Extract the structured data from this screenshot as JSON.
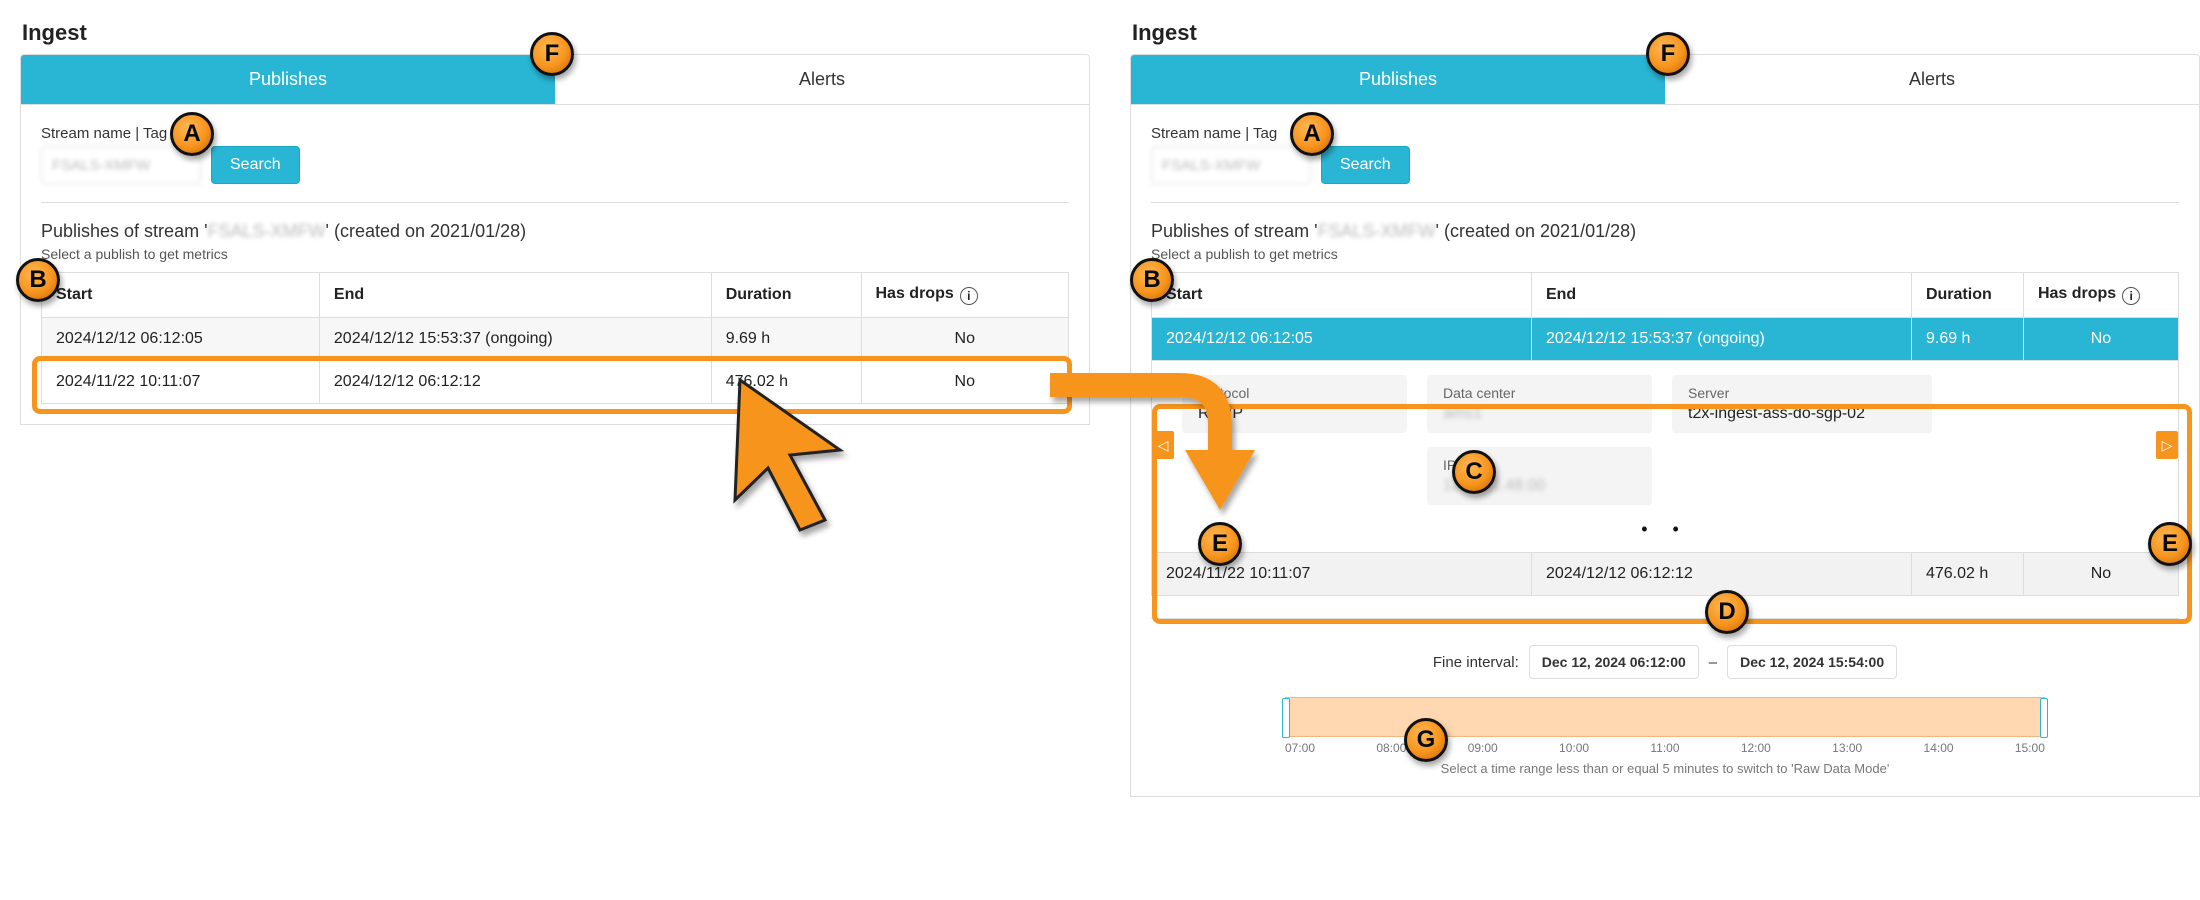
{
  "title": "Ingest",
  "tabs": {
    "publishes": "Publishes",
    "alerts": "Alerts"
  },
  "search": {
    "label": "Stream name | Tag",
    "button": "Search",
    "value": "FSALS-XMFW"
  },
  "subtitle_prefix": "Publishes of stream '",
  "subtitle_stream": "FSALS-XMFW",
  "subtitle_suffix": "' (created on 2021/01/28)",
  "hint": "Select a publish to get metrics",
  "columns": {
    "start": "Start",
    "end": "End",
    "duration": "Duration",
    "drops": "Has drops"
  },
  "rows": [
    {
      "start": "2024/12/12 06:12:05",
      "end": "2024/12/12 15:53:37 (ongoing)",
      "duration": "9.69 h",
      "drops": "No"
    },
    {
      "start": "2024/11/22 10:11:07",
      "end": "2024/12/12 06:12:12",
      "duration": "476.02 h",
      "drops": "No"
    }
  ],
  "details": {
    "protocol": {
      "label": "Protocol",
      "value": "RTMP"
    },
    "datacenter": {
      "label": "Data center",
      "value": "ams1"
    },
    "server": {
      "label": "Server",
      "value": "t2x-ingest-ass-do-sgp-02"
    },
    "ip": {
      "label": "IP",
      "value": "123.231.48.00"
    }
  },
  "dots": "•  •",
  "interval": {
    "label": "Fine interval:",
    "from": "Dec 12, 2024 06:12:00",
    "to": "Dec 12, 2024 15:54:00",
    "sep": "–",
    "ticks": [
      "07:00",
      "08:00",
      "09:00",
      "10:00",
      "11:00",
      "12:00",
      "13:00",
      "14:00",
      "15:00"
    ],
    "hint": "Select a time range less than or equal 5 minutes to switch to 'Raw Data Mode'"
  },
  "bubbles": [
    "A",
    "B",
    "C",
    "D",
    "E",
    "F",
    "G"
  ]
}
